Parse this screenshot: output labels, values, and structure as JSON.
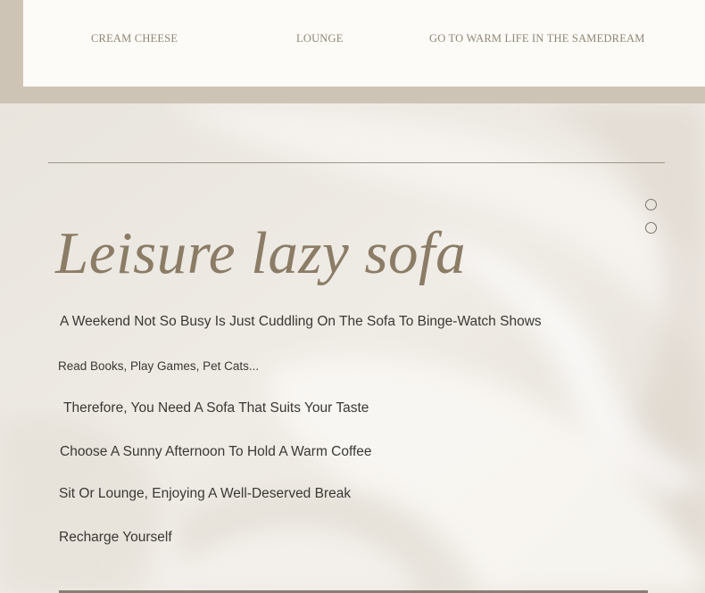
{
  "nav": {
    "items": [
      {
        "label": "CREAM CHEESE"
      },
      {
        "label": "LOUNGE"
      },
      {
        "label": "GO TO WARM LIFE IN THE SAMEDREAM"
      }
    ]
  },
  "hero": {
    "title": "Leisure lazy sofa",
    "lines": [
      "A Weekend Not So Busy Is Just Cuddling On The Sofa To Binge-Watch Shows",
      "Read Books, Play Games, Pet Cats...",
      "Therefore, You Need A Sofa That Suits Your Taste",
      "Choose A Sunny Afternoon To Hold A Warm Coffee",
      "Sit Or Lounge, Enjoying A Well-Deserved Break",
      "Recharge Yourself"
    ]
  },
  "colors": {
    "nav_band": "#cdc4b6",
    "nav_panel": "#fdfbf7",
    "title": "#8b7c66",
    "body_text": "#3a3835"
  },
  "icons": [
    "carousel-dot-icon",
    "carousel-dot-icon"
  ]
}
